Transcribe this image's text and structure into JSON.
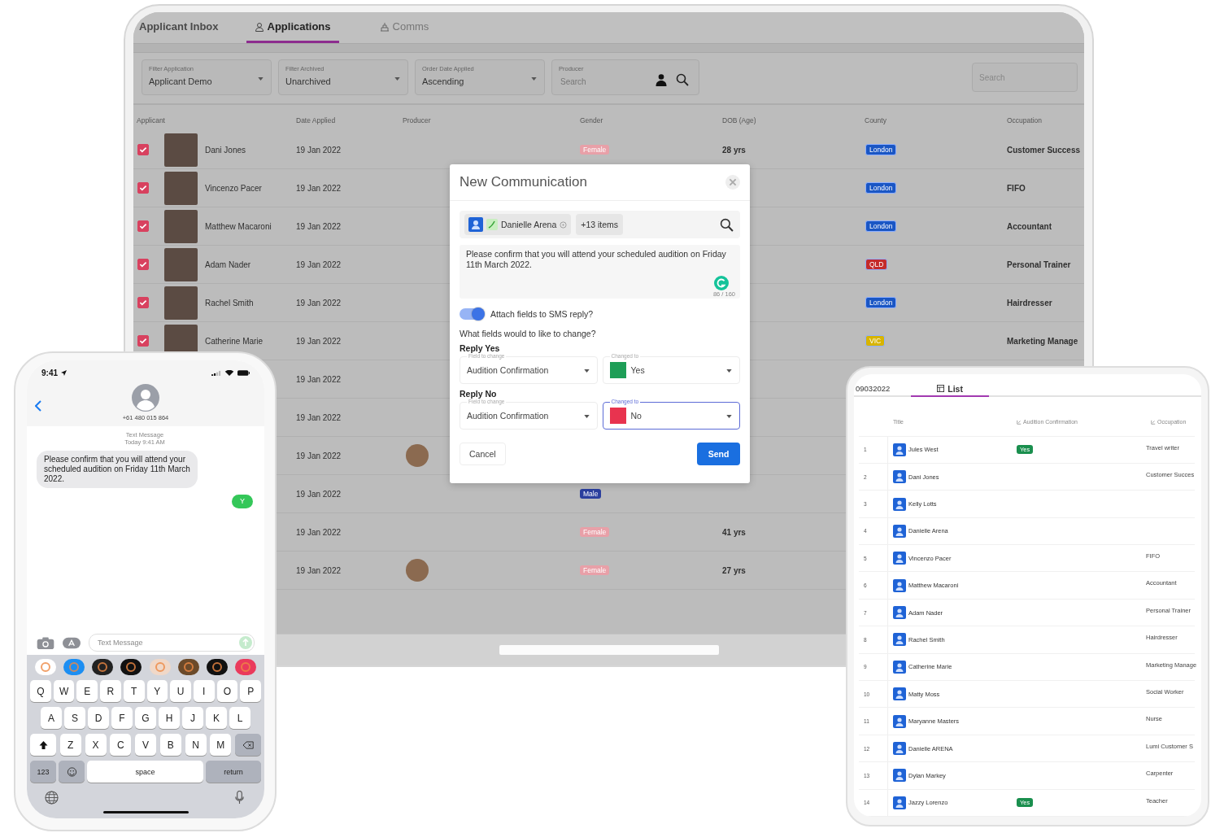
{
  "laptop": {
    "tabs": [
      {
        "label": "Applicant Inbox",
        "selected": false
      },
      {
        "label": "Applications",
        "selected": true
      },
      {
        "label": "Comms",
        "selected": false
      }
    ],
    "filters": [
      {
        "label": "Filter Application",
        "value": "Applicant Demo"
      },
      {
        "label": "Filter Archived",
        "value": "Unarchived"
      },
      {
        "label": "Order Date Applied",
        "value": "Ascending"
      }
    ],
    "producer": {
      "label": "Producer",
      "placeholder": "Search"
    },
    "search": {
      "placeholder": "Search"
    },
    "columns": [
      "Applicant",
      "Date Applied",
      "Producer",
      "Gender",
      "DOB (Age)",
      "County",
      "Occupation"
    ],
    "rows": [
      {
        "checked": true,
        "photo": true,
        "name": "Dani Jones",
        "date": "19 Jan 2022",
        "gender": {
          "label": "Female",
          "color": "#e8a0a8"
        },
        "age": "28 yrs",
        "county": {
          "label": "London",
          "color": "#1a56c4"
        },
        "occupation": "Customer Success"
      },
      {
        "checked": true,
        "photo": true,
        "name": "Vincenzo Pacer",
        "date": "19 Jan 2022",
        "county": {
          "label": "London",
          "color": "#1a56c4"
        },
        "occupation": "FIFO"
      },
      {
        "checked": true,
        "photo": true,
        "name": "Matthew Macaroni",
        "date": "19 Jan 2022",
        "county": {
          "label": "London",
          "color": "#1a56c4"
        },
        "occupation": "Accountant"
      },
      {
        "checked": true,
        "photo": true,
        "name": "Adam Nader",
        "date": "19 Jan 2022",
        "county": {
          "label": "QLD",
          "color": "#c42a2a"
        },
        "occupation": "Personal Trainer"
      },
      {
        "checked": true,
        "photo": true,
        "name": "Rachel Smith",
        "date": "19 Jan 2022",
        "county": {
          "label": "London",
          "color": "#1a56c4"
        },
        "occupation": "Hairdresser"
      },
      {
        "checked": true,
        "photo": true,
        "name": "Catherine Marie",
        "date": "19 Jan 2022",
        "county": {
          "label": "VIC",
          "color": "#d8b400"
        },
        "occupation": "Marketing Manage"
      },
      {
        "date": "19 Jan 2022"
      },
      {
        "date": "19 Jan 2022"
      },
      {
        "date": "19 Jan 2022",
        "producer_avatar": true
      },
      {
        "date": "19 Jan 2022",
        "gender": {
          "label": "Male",
          "color": "#2b3f9e"
        }
      },
      {
        "date": "19 Jan 2022",
        "gender": {
          "label": "Female",
          "color": "#e8a0a8"
        },
        "age": "41 yrs"
      },
      {
        "date": "19 Jan 2022",
        "producer_avatar": true,
        "gender": {
          "label": "Female",
          "color": "#e8a0a8"
        },
        "age": "27 yrs"
      }
    ]
  },
  "dialog": {
    "title": "New Communication",
    "recipient": "Danielle Arena",
    "more": "+13 items",
    "message": "Please confirm that you will attend your scheduled audition on Friday 11th March 2022.",
    "counter": "86 / 160",
    "attach": {
      "label": "Attach fields to SMS reply?",
      "on": true
    },
    "question": "What fields would to like to change?",
    "replies": [
      {
        "title": "Reply Yes",
        "field_label": "Field to change",
        "field_value": "Audition Confirmation",
        "target_label": "Changed to",
        "target_value": "Yes",
        "color": "#1e9e57",
        "focused": false
      },
      {
        "title": "Reply No",
        "field_label": "Field to change",
        "field_value": "Audition Confirmation",
        "target_label": "Changed to",
        "target_value": "No",
        "color": "#e8334f",
        "focused": true
      }
    ],
    "cancel": "Cancel",
    "send": "Send"
  },
  "phone": {
    "time": "9:41",
    "contact": "+61 480 015 864",
    "service": "Text Message",
    "timestamp": "Today 9:41 AM",
    "messages": [
      {
        "text": "Please confirm that you will attend your scheduled audition on Friday 11th March 2022.",
        "outgoing": false
      },
      {
        "text": "Y",
        "outgoing": true
      }
    ],
    "input": {
      "placeholder": "Text Message"
    },
    "keys": [
      [
        "Q",
        "W",
        "E",
        "R",
        "T",
        "Y",
        "U",
        "I",
        "O",
        "P"
      ],
      [
        "A",
        "S",
        "D",
        "F",
        "G",
        "H",
        "J",
        "K",
        "L"
      ],
      [
        "Z",
        "X",
        "C",
        "V",
        "B",
        "N",
        "M"
      ]
    ],
    "numbers": "123",
    "space": "space",
    "return": "return"
  },
  "tablet": {
    "tabs": [
      {
        "label": "09032022",
        "selected": false
      },
      {
        "label": "List",
        "selected": true
      }
    ],
    "columns": [
      "Title",
      "Audition Confirmation",
      "Occupation"
    ],
    "rows": [
      {
        "number": "1",
        "title": "Jules West",
        "confirmation": "Yes",
        "occupation": "Travel writer"
      },
      {
        "number": "2",
        "title": "Dani Jones",
        "occupation": "Customer Succes"
      },
      {
        "number": "3",
        "title": "Kelly Lotts"
      },
      {
        "number": "4",
        "title": "Danielle Arena"
      },
      {
        "number": "5",
        "title": "Vincenzo Pacer",
        "occupation": "FIFO"
      },
      {
        "number": "6",
        "title": "Matthew Macaroni",
        "occupation": "Accountant"
      },
      {
        "number": "7",
        "title": "Adam Nader",
        "occupation": "Personal Trainer"
      },
      {
        "number": "8",
        "title": "Rachel Smith",
        "occupation": "Hairdresser"
      },
      {
        "number": "9",
        "title": "Catherine Marie",
        "occupation": "Marketing Manage"
      },
      {
        "number": "10",
        "title": "Matty Moss",
        "occupation": "Social Worker"
      },
      {
        "number": "11",
        "title": "Maryanne Masters",
        "occupation": "Nurse"
      },
      {
        "number": "12",
        "title": "Danielle ARENA",
        "occupation": "Lumi Customer S"
      },
      {
        "number": "13",
        "title": "Dylan Markey",
        "occupation": "Carpenter"
      },
      {
        "number": "14",
        "title": "Jazzy Lorenzo",
        "confirmation": "Yes",
        "occupation": "Teacher"
      }
    ]
  }
}
